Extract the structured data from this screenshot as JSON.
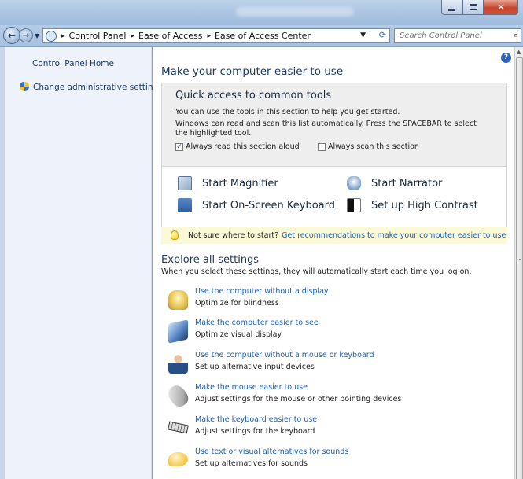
{
  "address": {
    "crumbs": [
      "Control Panel",
      "Ease of Access",
      "Ease of Access Center"
    ],
    "search_placeholder": "Search Control Panel"
  },
  "left_pane": {
    "home": "Control Panel Home",
    "admin": "Change administrative settings"
  },
  "main": {
    "heading": "Make your computer easier to use",
    "quick_access": {
      "title": "Quick access to common tools",
      "line1": "You can use the tools in this section to help you get started.",
      "line2": "Windows can read and scan this list automatically.  Press the SPACEBAR to select the highlighted tool.",
      "read_aloud": "Always read this section aloud",
      "read_aloud_checked": true,
      "scan": "Always scan this section",
      "scan_checked": false
    },
    "tools": [
      {
        "label": "Start Magnifier",
        "icon": "magnifier-icon"
      },
      {
        "label": "Start Narrator",
        "icon": "narrator-icon"
      },
      {
        "label": "Start On-Screen Keyboard",
        "icon": "keyboard-icon"
      },
      {
        "label": "Set up High Contrast",
        "icon": "contrast-icon"
      }
    ],
    "tip": {
      "text": "Not sure where to start?",
      "link": "Get recommendations to make your computer easier to use"
    },
    "explore": {
      "title": "Explore all settings",
      "subtitle": "When you select these settings, they will automatically start each time you log on."
    },
    "settings": [
      {
        "link": "Use the computer without a display",
        "desc": "Optimize for blindness",
        "icon": "display-icon"
      },
      {
        "link": "Make the computer easier to see",
        "desc": "Optimize visual display",
        "icon": "monitor-icon"
      },
      {
        "link": "Use the computer without a mouse or keyboard",
        "desc": "Set up alternative input devices",
        "icon": "person-icon"
      },
      {
        "link": "Make the mouse easier to use",
        "desc": "Adjust settings for the mouse or other pointing devices",
        "icon": "mouse-icon"
      },
      {
        "link": "Make the keyboard easier to use",
        "desc": "Adjust settings for the keyboard",
        "icon": "keyboard-small-icon"
      },
      {
        "link": "Use text or visual alternatives for sounds",
        "desc": "Set up alternatives for sounds",
        "icon": "speech-bubble-icon"
      }
    ]
  },
  "colors": {
    "link": "#1a5fb4",
    "heading": "#1e395b",
    "tip_bg": "#fbf9d6",
    "panel_bg": "#eeeeee"
  }
}
